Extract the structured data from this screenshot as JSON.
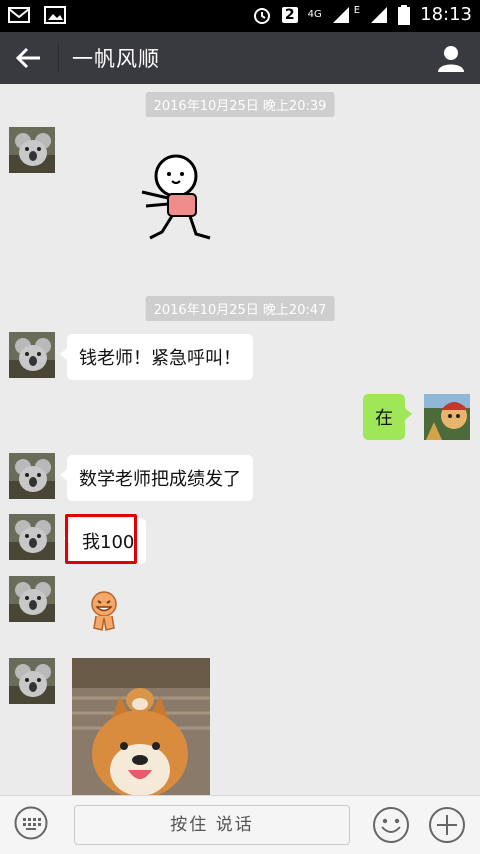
{
  "status_bar": {
    "sim_badge": "2",
    "network": "4G",
    "signal_type": "E",
    "time": "18:13"
  },
  "header": {
    "title": "一帆风顺"
  },
  "chat": {
    "timestamp_1": "2016年10月25日 晚上20:39",
    "timestamp_2": "2016年10月25日 晚上20:47",
    "messages": [
      {
        "side": "in",
        "text": "钱老师！紧急呼叫！"
      },
      {
        "side": "out",
        "text": "在"
      },
      {
        "side": "in",
        "text": "数学老师把成绩发了"
      },
      {
        "side": "in",
        "text": "我100"
      }
    ]
  },
  "input_bar": {
    "voice_label": "按住 说话"
  },
  "colors": {
    "header_bg": "#393a3f",
    "chat_bg": "#ebebeb",
    "out_bubble": "#9fe658",
    "in_bubble": "#ffffff",
    "highlight": "#e10000"
  }
}
